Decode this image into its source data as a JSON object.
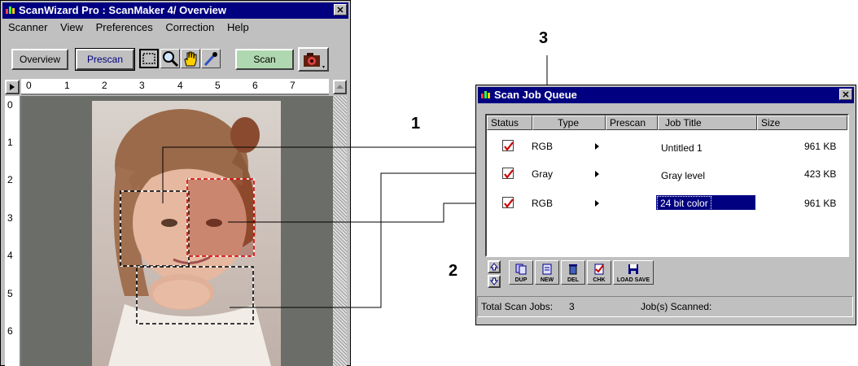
{
  "main_window": {
    "title": "ScanWizard Pro : ScanMaker 4/ Overview",
    "close_label": "✕",
    "menu": [
      "Scanner",
      "View",
      "Preferences",
      "Correction",
      "Help"
    ],
    "buttons": {
      "overview": "Overview",
      "prescan": "Prescan",
      "scan": "Scan"
    },
    "tools": [
      "marquee-tool",
      "zoom-tool",
      "hand-tool",
      "eyedropper-tool"
    ],
    "ruler_h": [
      "0",
      "1",
      "2",
      "3",
      "4",
      "5",
      "6",
      "7"
    ],
    "ruler_v": [
      "0",
      "1",
      "2",
      "3",
      "4",
      "5",
      "6"
    ]
  },
  "queue_window": {
    "title": "Scan Job Queue",
    "close_label": "✕",
    "columns": [
      "Status",
      "Type",
      "Prescan",
      "Job Title",
      "Size"
    ],
    "rows": [
      {
        "type": "RGB",
        "title": "Untitled 1",
        "size": "961 KB",
        "checked": true
      },
      {
        "type": "Gray",
        "title": "Gray level",
        "size": "423 KB",
        "checked": true
      },
      {
        "type": "RGB",
        "title": "24 bit color",
        "size": "961 KB",
        "checked": true,
        "selected": true
      }
    ],
    "tool_buttons": [
      "DUP",
      "NEW",
      "DEL",
      "CHK",
      "LOAD SAVE"
    ],
    "status": {
      "total_label": "Total Scan Jobs:",
      "total_value": "3",
      "scanned_label": "Job(s) Scanned:"
    }
  },
  "callouts": [
    "1",
    "2",
    "3"
  ],
  "colors": {
    "titlebar": "#000080",
    "window": "#c0c0c0",
    "check": "#cc0000",
    "scan_btn": "#b0d8b0"
  }
}
